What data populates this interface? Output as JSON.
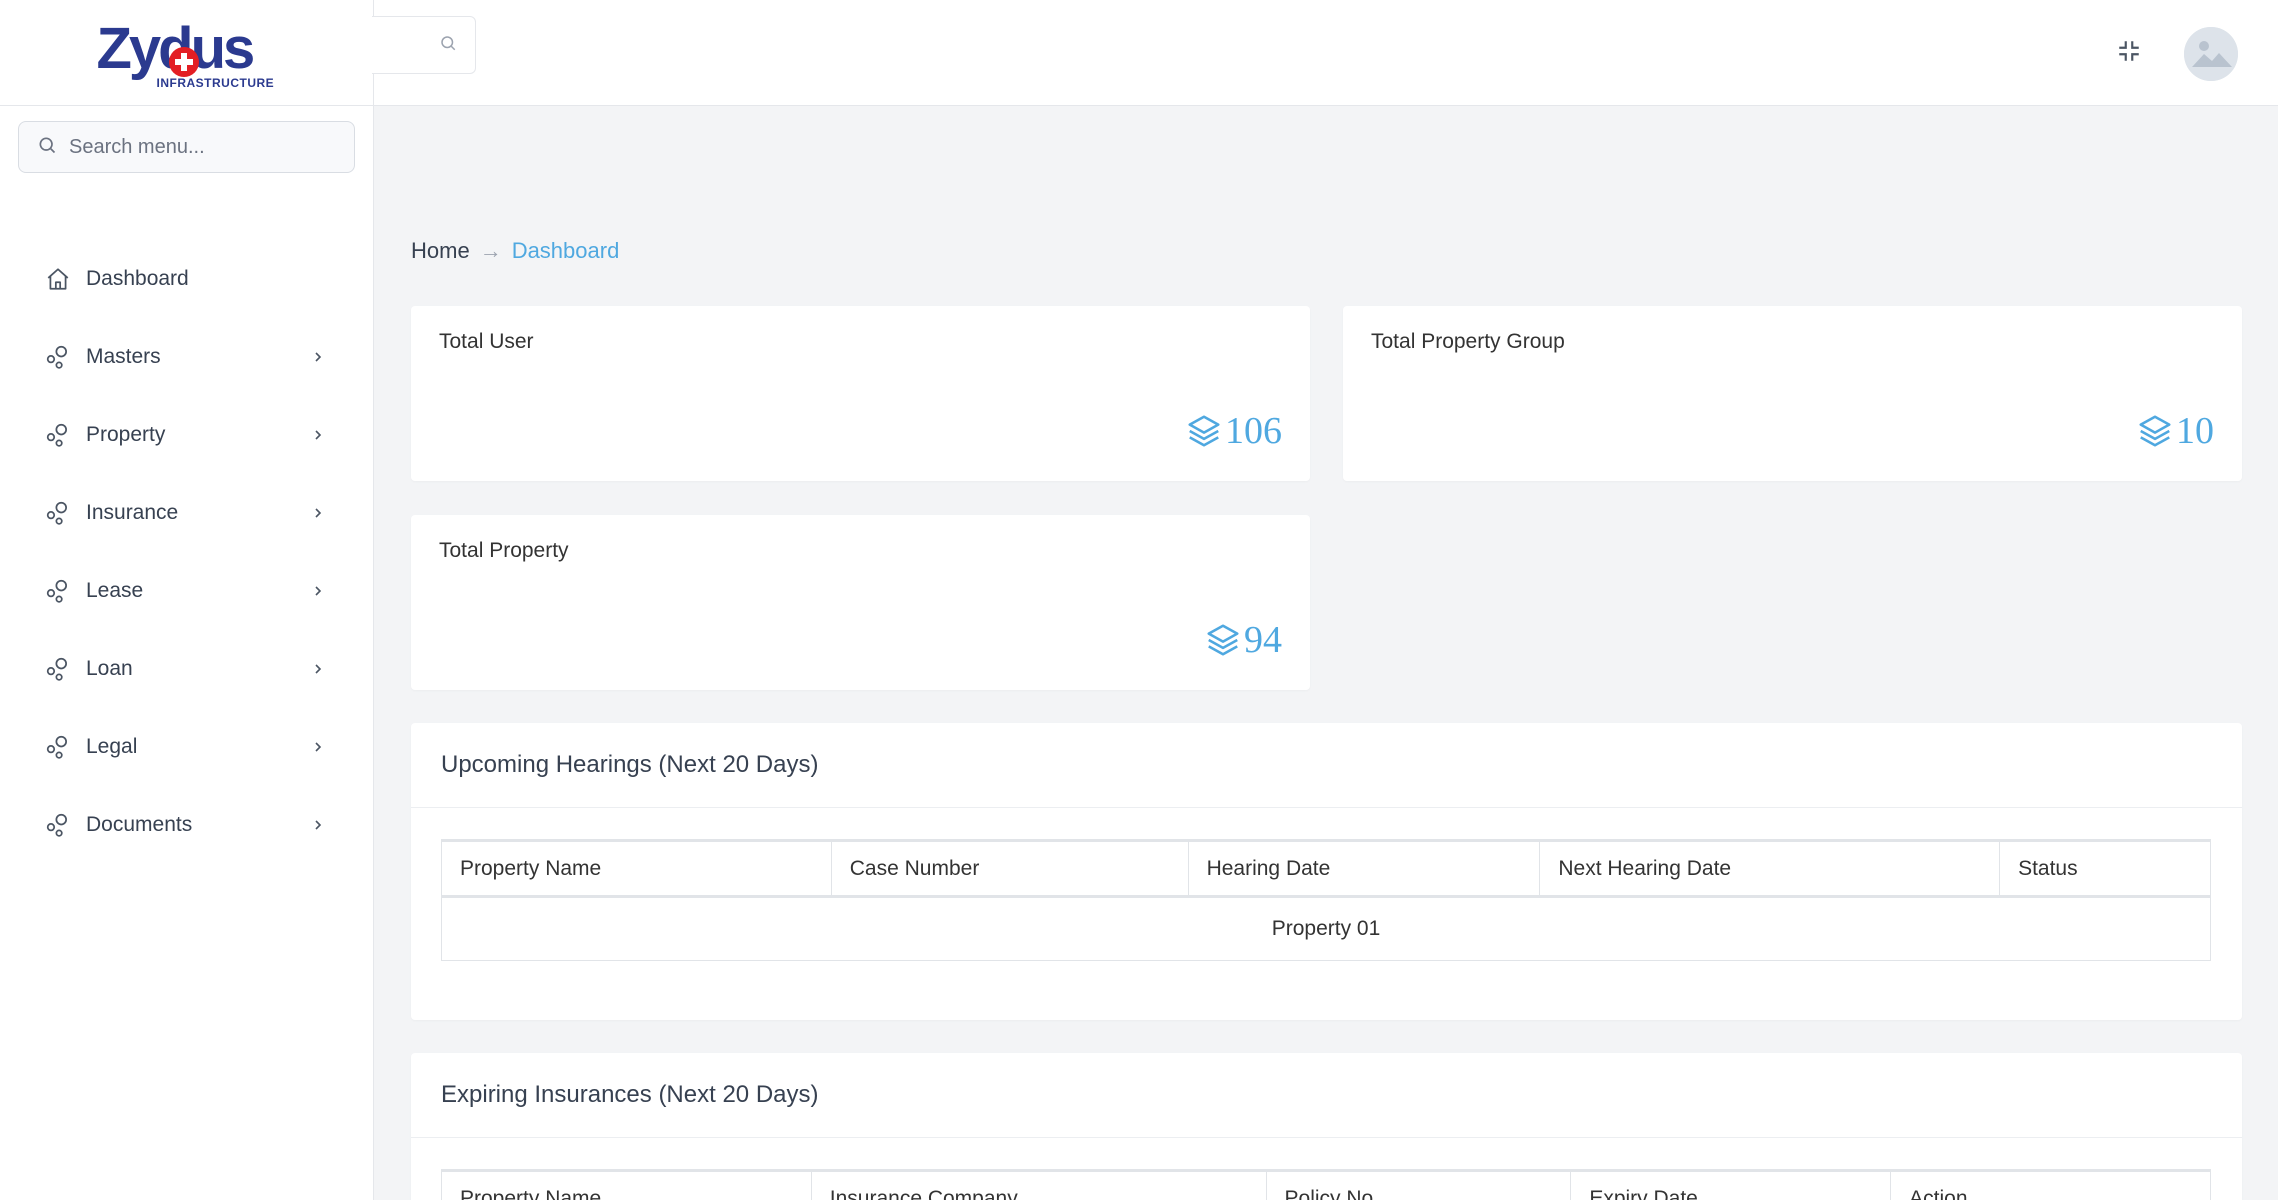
{
  "brand": {
    "name": "Zydus",
    "sub": "INFRASTRUCTURE"
  },
  "sidebar": {
    "search_placeholder": "Search menu...",
    "items": [
      {
        "label": "Dashboard",
        "icon": "home-icon",
        "has_children": false
      },
      {
        "label": "Masters",
        "icon": "circles-icon",
        "has_children": true
      },
      {
        "label": "Property",
        "icon": "circles-icon",
        "has_children": true
      },
      {
        "label": "Insurance",
        "icon": "circles-icon",
        "has_children": true
      },
      {
        "label": "Lease",
        "icon": "circles-icon",
        "has_children": true
      },
      {
        "label": "Loan",
        "icon": "circles-icon",
        "has_children": true
      },
      {
        "label": "Legal",
        "icon": "circles-icon",
        "has_children": true
      },
      {
        "label": "Documents",
        "icon": "circles-icon",
        "has_children": true
      }
    ]
  },
  "topbar": {
    "search_icon": "search-icon",
    "fullscreen_icon": "compress-icon",
    "avatar_icon": "image-placeholder-icon"
  },
  "breadcrumb": {
    "home": "Home",
    "separator": "→",
    "current": "Dashboard"
  },
  "stats": {
    "total_user": {
      "label": "Total User",
      "value": "106"
    },
    "total_property_group": {
      "label": "Total Property Group",
      "value": "10"
    },
    "total_property": {
      "label": "Total Property",
      "value": "94"
    }
  },
  "hearings": {
    "title": "Upcoming Hearings (Next 20 Days)",
    "columns": [
      "Property Name",
      "Case Number",
      "Hearing Date",
      "Next Hearing Date",
      "Status"
    ],
    "rows": [
      {
        "text": "Property 01"
      }
    ]
  },
  "insurances": {
    "title": "Expiring Insurances (Next 20 Days)",
    "columns": [
      "Property Name",
      "Insurance Company",
      "Policy No",
      "Expiry Date",
      "Action"
    ]
  },
  "colors": {
    "accent": "#4fa8e0",
    "brand_blue": "#2b3a8f",
    "brand_red": "#e31e24"
  }
}
